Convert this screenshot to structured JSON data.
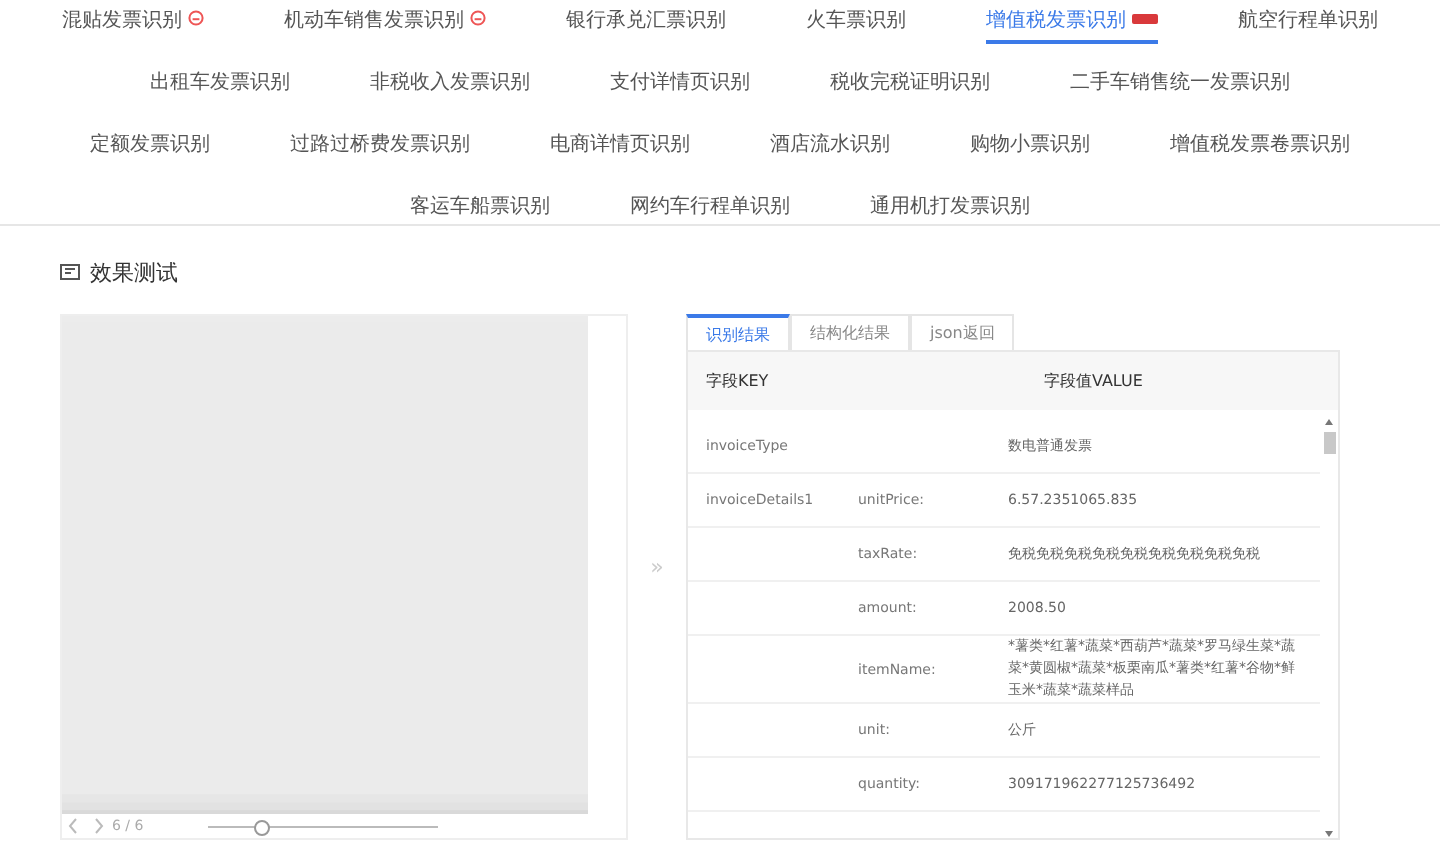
{
  "nav_rows": [
    [
      {
        "label": "混贴发票识别",
        "selected": false,
        "badge": {
          "kind": "circle"
        }
      },
      {
        "label": "机动车销售发票识别",
        "selected": false,
        "badge": {
          "kind": "circle"
        }
      },
      {
        "label": "银行承兑汇票识别",
        "selected": false
      },
      {
        "label": "火车票识别",
        "selected": false
      },
      {
        "label": "增值税发票识别",
        "selected": true,
        "badge": {
          "kind": "tag"
        }
      },
      {
        "label": "航空行程单识别",
        "selected": false
      }
    ],
    [
      {
        "label": "出租车发票识别",
        "selected": false
      },
      {
        "label": "非税收入发票识别",
        "selected": false
      },
      {
        "label": "支付详情页识别",
        "selected": false
      },
      {
        "label": "税收完税证明识别",
        "selected": false
      },
      {
        "label": "二手车销售统一发票识别",
        "selected": false
      }
    ],
    [
      {
        "label": "定额发票识别",
        "selected": false
      },
      {
        "label": "过路过桥费发票识别",
        "selected": false
      },
      {
        "label": "电商详情页识别",
        "selected": false
      },
      {
        "label": "酒店流水识别",
        "selected": false
      },
      {
        "label": "购物小票识别",
        "selected": false
      },
      {
        "label": "增值税发票卷票识别",
        "selected": false
      }
    ],
    [
      {
        "label": "客运车船票识别",
        "selected": false
      },
      {
        "label": "网约车行程单识别",
        "selected": false
      },
      {
        "label": "通用机打发票识别",
        "selected": false
      }
    ]
  ],
  "section_title": "效果测试",
  "viewer": {
    "page": "6 / 6",
    "zoom": {
      "level": 0.24
    },
    "expand_icon": "»"
  },
  "result_tabs": [
    {
      "label": "识别结果",
      "selected": true
    },
    {
      "label": "结构化结果",
      "selected": false
    },
    {
      "label": "json返回",
      "selected": false
    }
  ],
  "table": {
    "columns": [
      "字段KEY",
      "字段值VALUE"
    ],
    "rows": [
      {
        "key": "invoiceType",
        "field": "",
        "value": "数电普通发票"
      },
      {
        "key": "invoiceDetails1",
        "field": "unitPrice:",
        "value": "6.57.2351065.835"
      },
      {
        "key": "",
        "field": "taxRate:",
        "value": "免税免税免税免税免税免税免税免税免税"
      },
      {
        "key": "",
        "field": "amount:",
        "value": "2008.50"
      },
      {
        "key": "",
        "field": "itemName:",
        "value": "*薯类*红薯*蔬菜*西葫芦*蔬菜*罗马绿生菜*蔬菜*黄圆椒*蔬菜*板栗南瓜*薯类*红薯*谷物*鲜玉米*蔬菜*蔬菜样品"
      },
      {
        "key": "",
        "field": "unit:",
        "value": "公斤"
      },
      {
        "key": "",
        "field": "quantity:",
        "value": "309171962277125736492"
      }
    ]
  }
}
